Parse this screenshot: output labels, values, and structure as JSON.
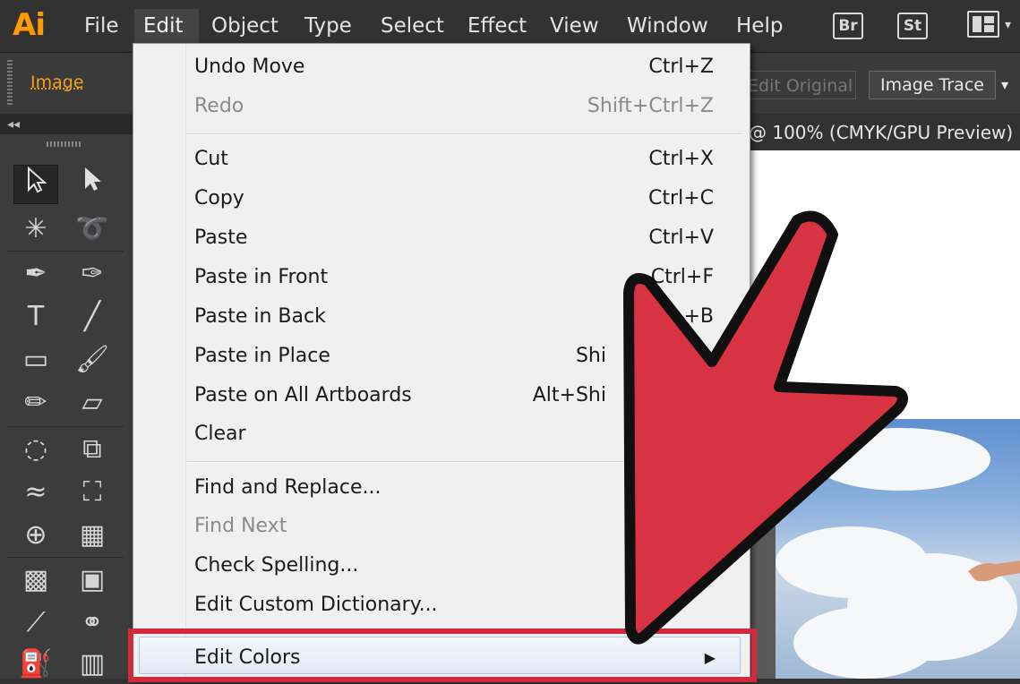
{
  "app": {
    "logo": "Ai",
    "menu": [
      "File",
      "Edit",
      "Object",
      "Type",
      "Select",
      "Effect",
      "View",
      "Window",
      "Help"
    ],
    "active_menu": "Edit",
    "bridge": "Br",
    "stock": "St"
  },
  "control_bar": {
    "selection_type": "Image",
    "edit_original": "Edit Original",
    "image_trace": "Image Trace"
  },
  "document": {
    "tab_title": "@ 100% (CMYK/GPU Preview)"
  },
  "edit_menu": {
    "items": [
      {
        "label": "Undo Move",
        "shortcut": "Ctrl+Z",
        "enabled": true
      },
      {
        "label": "Redo",
        "shortcut": "Shift+Ctrl+Z",
        "enabled": false
      },
      {
        "label": "Cut",
        "shortcut": "Ctrl+X",
        "enabled": true
      },
      {
        "label": "Copy",
        "shortcut": "Ctrl+C",
        "enabled": true
      },
      {
        "label": "Paste",
        "shortcut": "Ctrl+V",
        "enabled": true
      },
      {
        "label": "Paste in Front",
        "shortcut": "Ctrl+F",
        "enabled": true
      },
      {
        "label": "Paste in Back",
        "shortcut": "+B",
        "enabled": true
      },
      {
        "label": "Paste in Place",
        "shortcut": "Shi",
        "enabled": true
      },
      {
        "label": "Paste on All Artboards",
        "shortcut": "Alt+Shi",
        "enabled": true
      },
      {
        "label": "Clear",
        "shortcut": "",
        "enabled": true
      },
      {
        "label": "Find and Replace...",
        "shortcut": "",
        "enabled": true
      },
      {
        "label": "Find Next",
        "shortcut": "",
        "enabled": false
      },
      {
        "label": "Check Spelling...",
        "shortcut": "",
        "enabled": true
      },
      {
        "label": "Edit Custom Dictionary...",
        "shortcut": "",
        "enabled": true
      },
      {
        "label": "Edit Colors",
        "shortcut": "",
        "enabled": true,
        "submenu": true,
        "highlighted": true
      }
    ]
  },
  "tools": [
    "selection-tool",
    "direct-selection-tool",
    "magic-wand-tool",
    "lasso-tool",
    "pen-tool",
    "curvature-tool",
    "type-tool",
    "line-segment-tool",
    "rectangle-tool",
    "paintbrush-tool",
    "pencil-tool",
    "eraser-tool",
    "rotate-tool",
    "scale-tool",
    "width-tool",
    "free-transform-tool",
    "shape-builder-tool",
    "perspective-grid-tool",
    "mesh-tool",
    "gradient-tool",
    "eyedropper-tool",
    "blend-tool",
    "symbol-sprayer-tool",
    "column-graph-tool"
  ],
  "colors": {
    "accent_orange": "#ff9a00",
    "annotation_red": "#d22a3c"
  }
}
